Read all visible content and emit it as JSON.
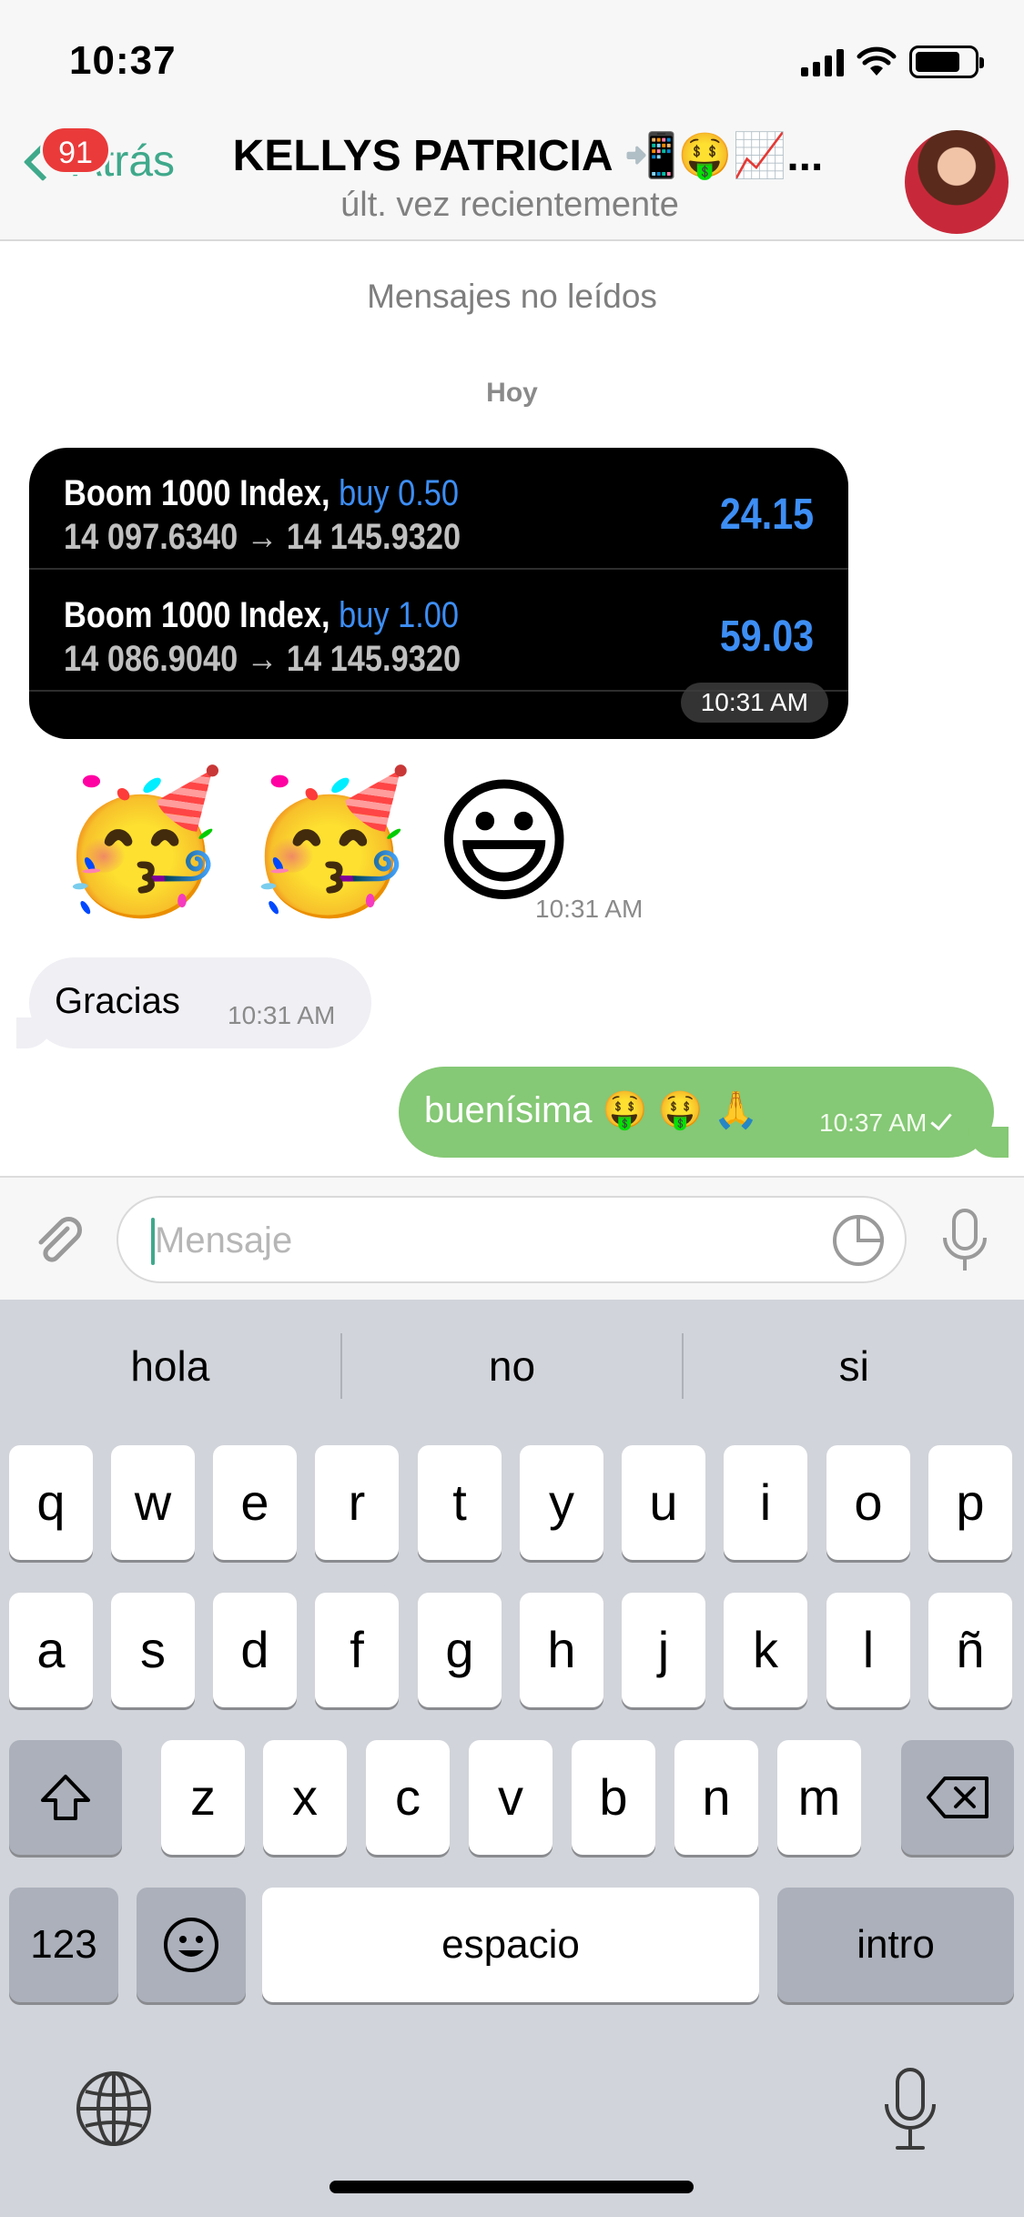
{
  "status_bar": {
    "time": "10:37"
  },
  "header": {
    "back_label": "Atrás",
    "unread_badge": "91",
    "title": "KELLYS PATRICIA 📲🤑📈...",
    "subtitle": "últ. vez recientemente"
  },
  "chat": {
    "unread_divider": "Mensajes no leídos",
    "day_label": "Hoy",
    "trade_card": {
      "time": "10:31 AM",
      "trades": [
        {
          "instrument": "Boom 1000 Index,",
          "action": "buy 0.50",
          "prices": "14 097.6340 → 14 145.9320",
          "profit": "24.15"
        },
        {
          "instrument": "Boom 1000 Index,",
          "action": "buy 1.00",
          "prices": "14 086.9040 → 14 145.9320",
          "profit": "59.03"
        }
      ]
    },
    "emoji_message": {
      "emojis": [
        "🥳",
        "🥳",
        "😃"
      ],
      "time": "10:31 AM"
    },
    "incoming": {
      "text": "Gracias",
      "time": "10:31 AM"
    },
    "outgoing": {
      "text": "buenísima 🤑 🤑 🙏",
      "time": "10:37 AM"
    }
  },
  "composer": {
    "placeholder": "Mensaje"
  },
  "keyboard": {
    "suggestions": [
      "hola",
      "no",
      "si"
    ],
    "row1": [
      "q",
      "w",
      "e",
      "r",
      "t",
      "y",
      "u",
      "i",
      "o",
      "p"
    ],
    "row2": [
      "a",
      "s",
      "d",
      "f",
      "g",
      "h",
      "j",
      "k",
      "l",
      "ñ"
    ],
    "row3": [
      "z",
      "x",
      "c",
      "v",
      "b",
      "n",
      "m"
    ],
    "numbers_key": "123",
    "space_key": "espacio",
    "return_key": "intro"
  },
  "colors": {
    "accent": "#3fa98b",
    "outgoing_bubble": "#85c875",
    "badge": "#ea3a3a",
    "trade_value": "#3d8ef5"
  }
}
